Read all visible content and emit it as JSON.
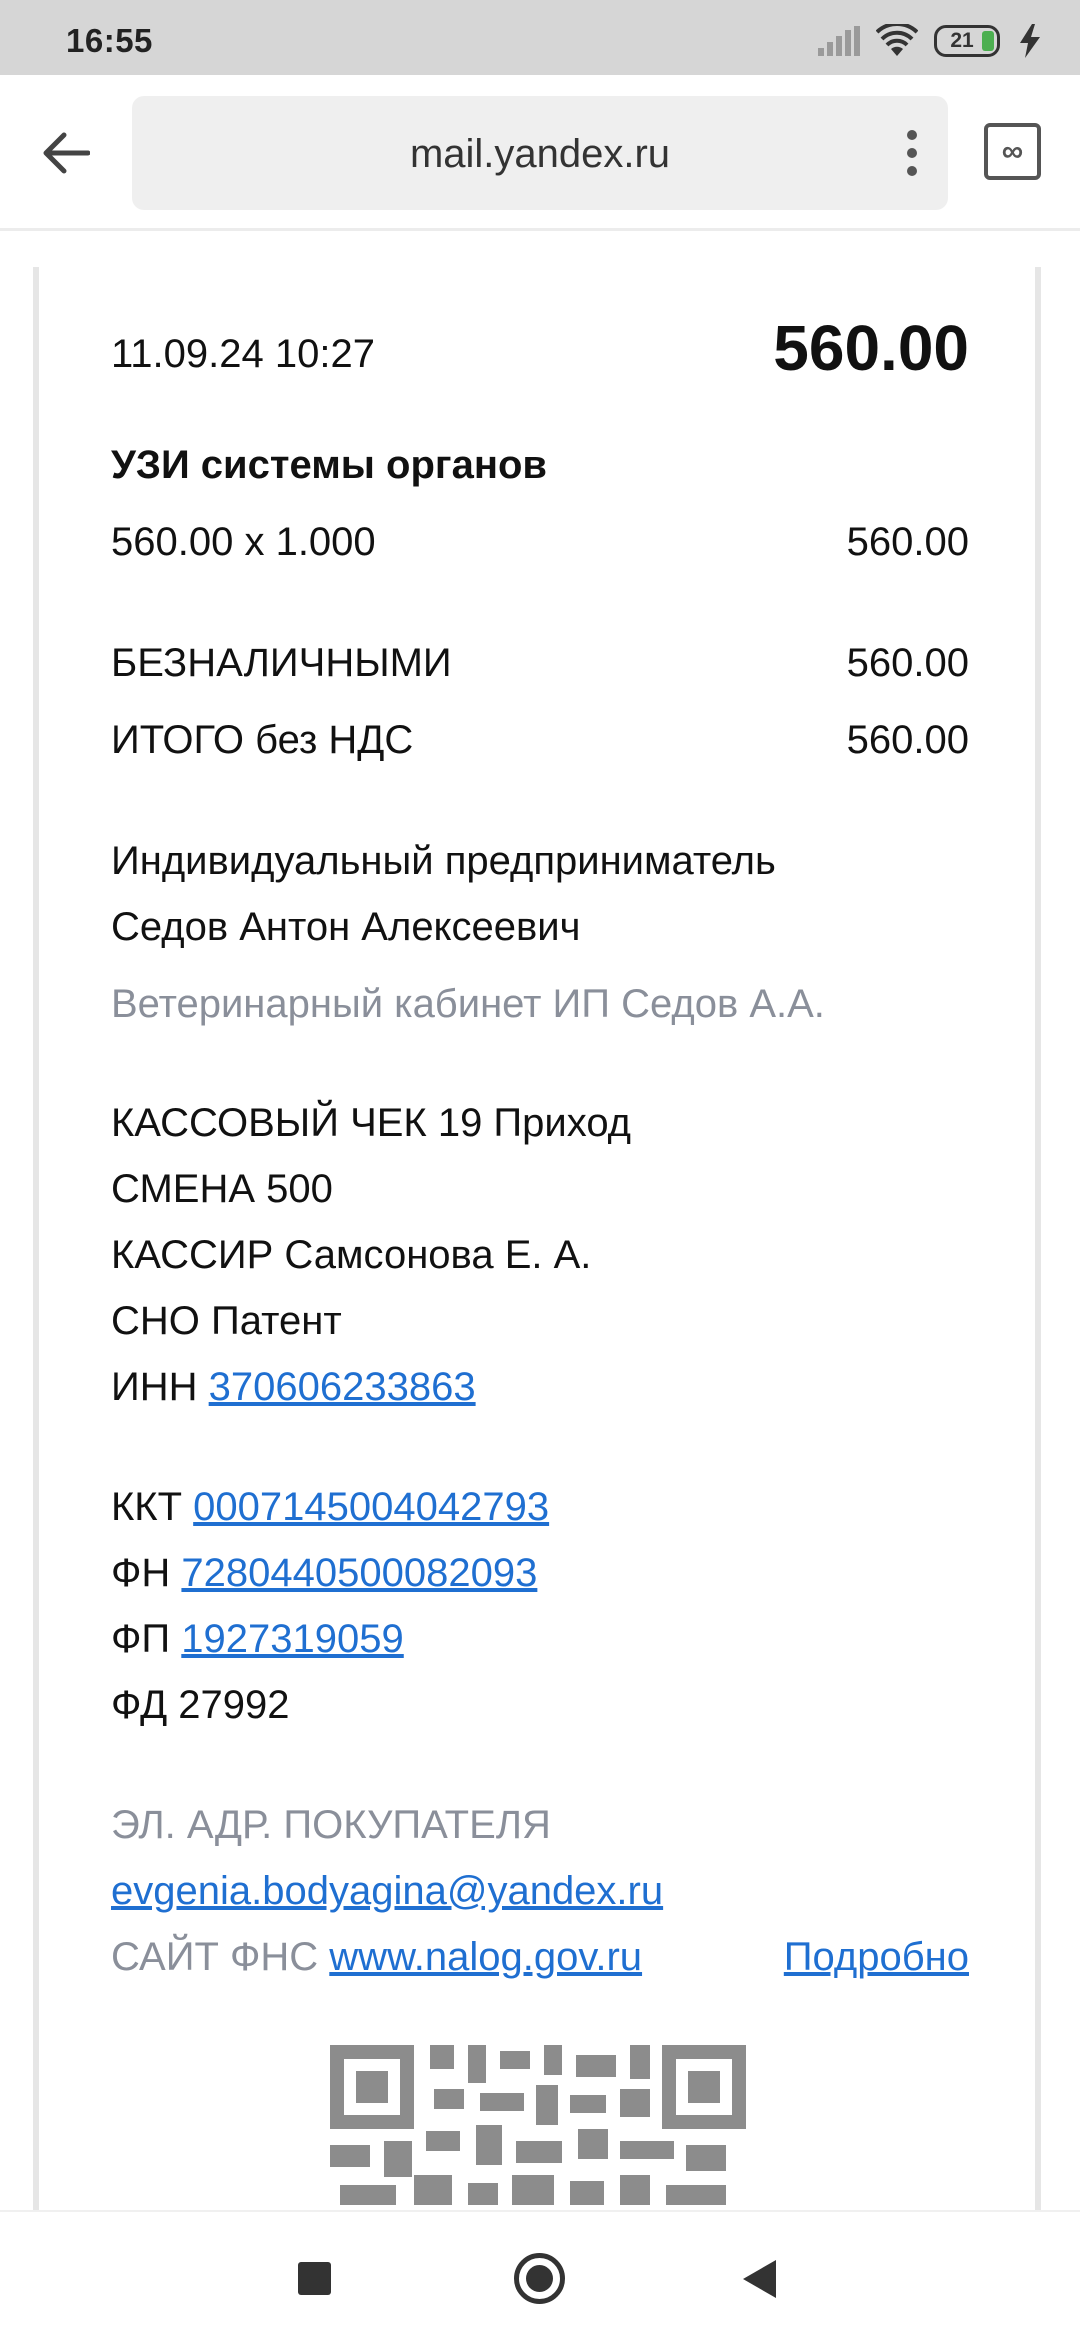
{
  "status_bar": {
    "time": "16:55",
    "battery_level": "21",
    "icons": [
      "signal-icon",
      "wifi-icon",
      "battery-icon",
      "charging-icon"
    ]
  },
  "browser": {
    "url": "mail.yandex.ru",
    "tabs_label": "∞"
  },
  "receipt": {
    "datetime": "11.09.24 10:27",
    "total_top": "560.00",
    "item_name": "УЗИ системы органов",
    "item_qty": "560.00 x 1.000",
    "item_sum": "560.00",
    "payment_label": "БЕЗНАЛИЧНЫМИ",
    "payment_value": "560.00",
    "total_label": "ИТОГО без НДС",
    "total_value": "560.00",
    "seller_line1": "Индивидуальный предприниматель",
    "seller_line2": "Седов Антон Алексеевич",
    "seller_place": "Ветеринарный кабинет ИП Седов А.А.",
    "check_line": "КАССОВЫЙ ЧЕК 19 Приход",
    "shift_line": "СМЕНА 500",
    "cashier_line": "КАССИР Самсонова Е. А.",
    "tax_system": "СНО Патент",
    "inn_label": "ИНН",
    "inn_value": "370606233863",
    "kkt_label": "ККТ",
    "kkt_value": "0007145004042793",
    "fn_label": "ФН",
    "fn_value": "7280440500082093",
    "fp_label": "ФП",
    "fp_value": "1927319059",
    "fd_line": "ФД 27992",
    "buyer_email_label": "ЭЛ. АДР. ПОКУПАТЕЛЯ",
    "buyer_email": "evgenia.bodyagina@yandex.ru",
    "fns_site_label": "САЙТ ФНС",
    "fns_site": "www.nalog.gov.ru",
    "details_link": "Подробно"
  },
  "colors": {
    "link": "#1f6fd1",
    "muted": "#8a8f9a",
    "status_bar_bg": "#d6d6d6",
    "battery_fill": "#4caf50"
  }
}
